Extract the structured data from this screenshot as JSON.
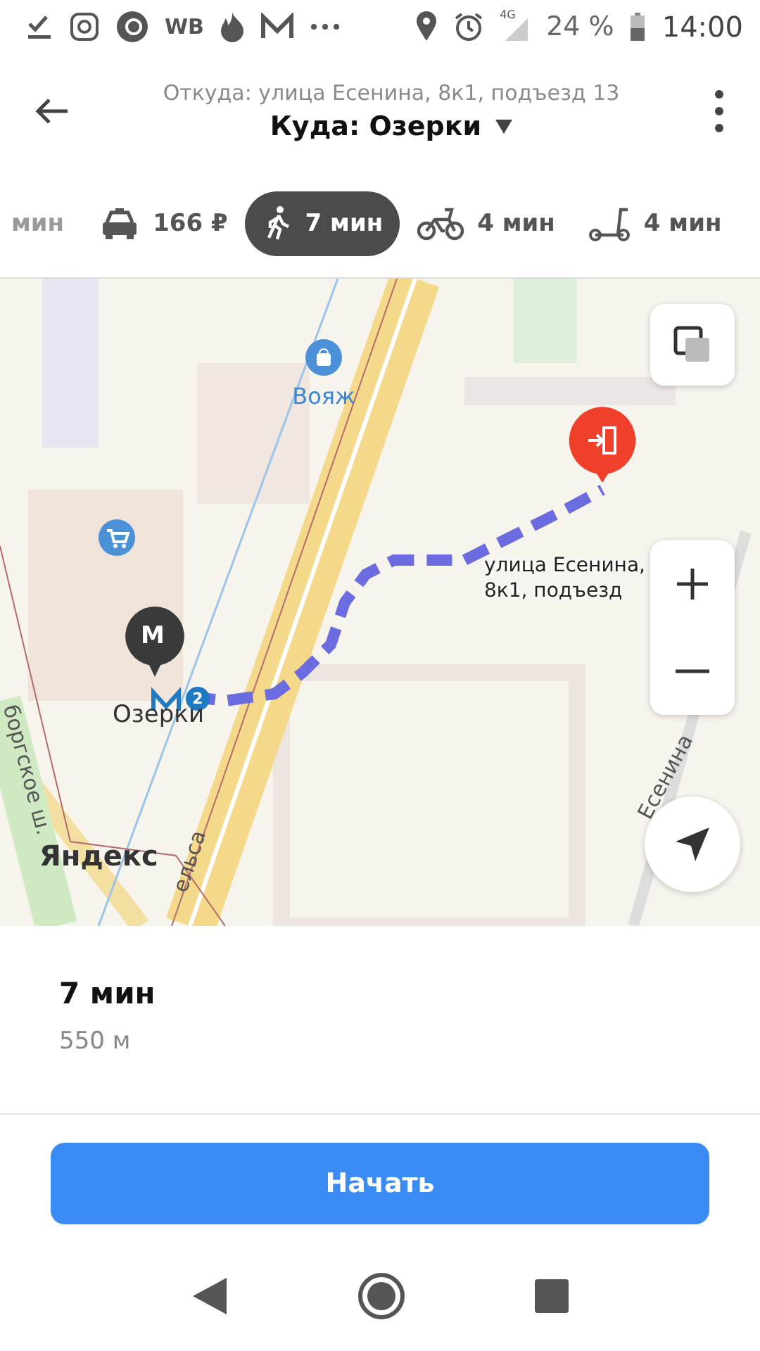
{
  "status_bar": {
    "wb_label": "WB",
    "network": "4G",
    "battery": "24 %",
    "time": "14:00"
  },
  "header": {
    "from": "Откуда: улица Есенина, 8к1, подъезд 13",
    "to": "Куда: Озерки"
  },
  "modes": [
    {
      "kind": "transit",
      "label": "мин",
      "selected": false
    },
    {
      "kind": "taxi",
      "label": "166 ₽",
      "selected": false
    },
    {
      "kind": "walk",
      "label": "7 мин",
      "selected": true
    },
    {
      "kind": "bike",
      "label": "4 мин",
      "selected": false
    },
    {
      "kind": "scooter",
      "label": "4 мин",
      "selected": false
    }
  ],
  "map": {
    "labels": [
      {
        "kind": "poi",
        "text": "Вояж"
      },
      {
        "kind": "address",
        "text": "улица Есенина, 8к1, подъезд"
      },
      {
        "kind": "station",
        "text": "Озерки"
      },
      {
        "kind": "logo",
        "text": "Яндекс"
      },
      {
        "kind": "street",
        "text": "боргское ш."
      },
      {
        "kind": "street",
        "text": "ельса"
      },
      {
        "kind": "street",
        "text": "Есенина"
      }
    ],
    "metro_pin": "M",
    "metro_line": "2"
  },
  "summary": {
    "duration": "7 мин",
    "distance": "550 м"
  },
  "start_button": "Начать"
}
